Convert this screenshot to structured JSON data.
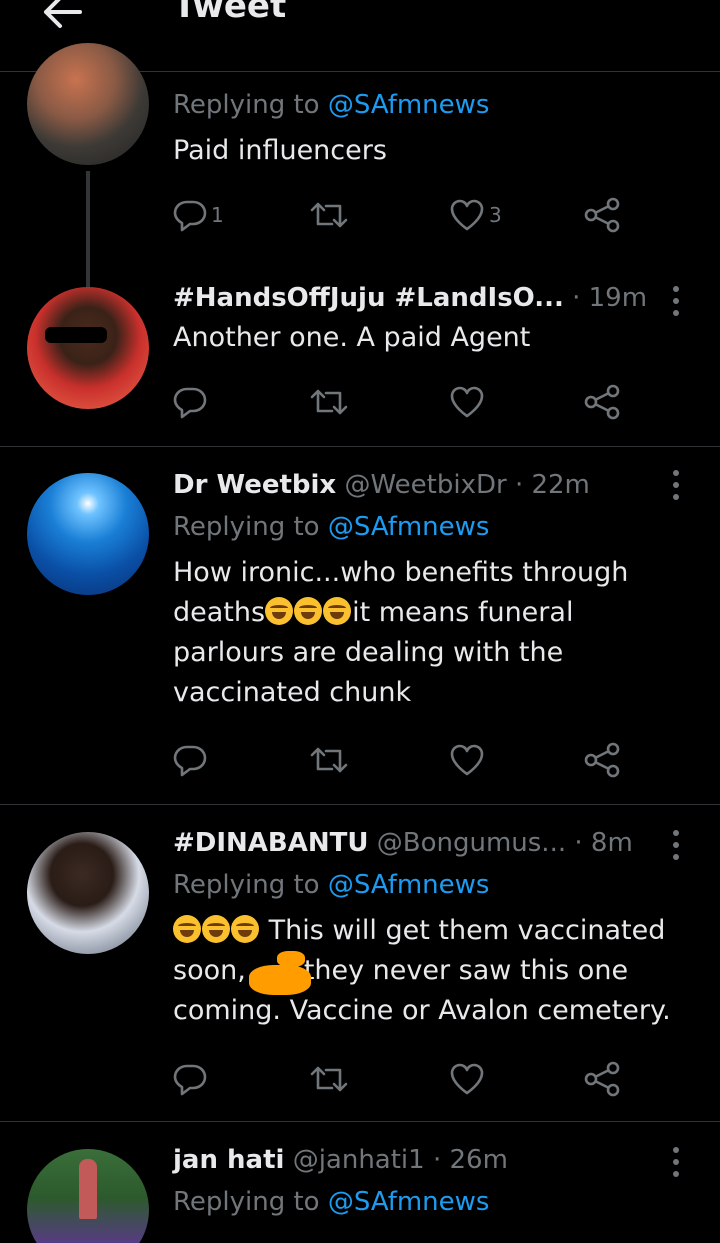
{
  "header": {
    "title": "Tweet"
  },
  "tweets": [
    {
      "reply_prefix": "Replying to",
      "reply_handle": "@SAfmnews",
      "body": "Paid influencers",
      "reply_count": "1",
      "like_count": "3"
    },
    {
      "name": "#HandsOffJuju #LandIsO...",
      "time": "· 19m",
      "body": "Another one. A paid Agent"
    },
    {
      "name": "Dr Weetbix",
      "handle": "@WeetbixDr",
      "time": "· 22m",
      "reply_prefix": "Replying to",
      "reply_handle": "@SAfmnews",
      "body_1": "How ironic...who benefits through",
      "body_2a": "deaths",
      "body_2b": "it means funeral",
      "body_3": "parlours are dealing with the",
      "body_4": "vaccinated chunk"
    },
    {
      "name": "#DINABANTU",
      "handle": "@Bongumus...",
      "time": "· 8m",
      "reply_prefix": "Replying to",
      "reply_handle": "@SAfmnews",
      "body_1": " This will get them vaccinated",
      "body_2a": "soon,",
      "body_2b": "they never saw this one",
      "body_3": "coming. Vaccine or Avalon cemetery."
    },
    {
      "name": "jan hati",
      "handle": "@janhati1",
      "time": "· 26m",
      "reply_prefix": "Replying to",
      "reply_handle": "@SAfmnews"
    }
  ],
  "colors": {
    "accent": "#1d9bf0",
    "muted": "#71767b",
    "text": "#e7e9ea",
    "background": "#000000"
  }
}
